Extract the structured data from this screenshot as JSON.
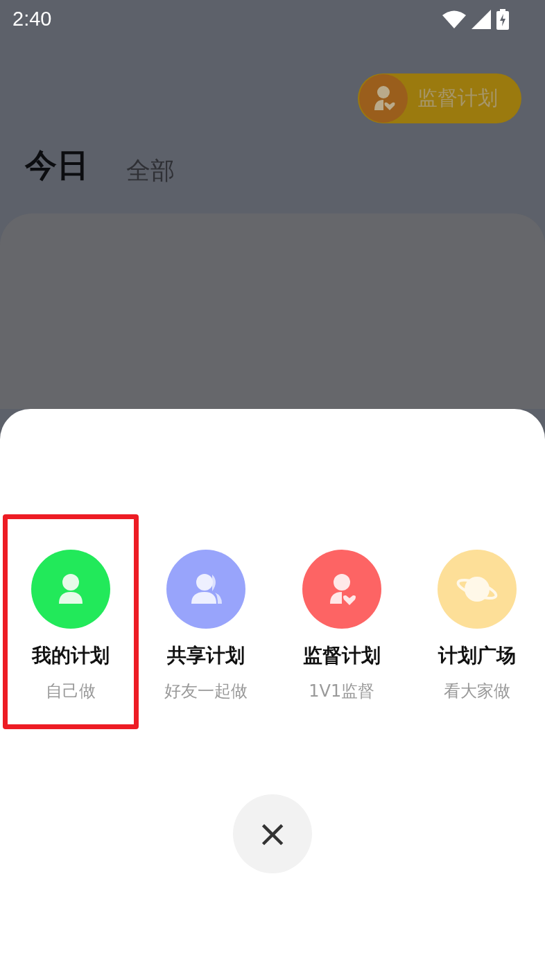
{
  "status_bar": {
    "time": "2:40"
  },
  "supervise_button": {
    "label": "监督计划"
  },
  "tabs": [
    {
      "label": "今日",
      "selected": true
    },
    {
      "label": "全部",
      "selected": false
    }
  ],
  "sheet": {
    "options": [
      {
        "kind": "person",
        "color": "#22e95a",
        "title": "我的计划",
        "subtitle": "自己做",
        "highlighted": true
      },
      {
        "kind": "group",
        "color": "#98a4fb",
        "title": "共享计划",
        "subtitle": "好友一起做",
        "highlighted": false
      },
      {
        "kind": "supervise",
        "color": "#fd6464",
        "title": "监督计划",
        "subtitle": "1V1监督",
        "highlighted": false
      },
      {
        "kind": "planet",
        "color": "#fddf98",
        "title": "计划广场",
        "subtitle": "看大家做",
        "highlighted": false
      }
    ],
    "close": {
      "label": "×"
    }
  }
}
